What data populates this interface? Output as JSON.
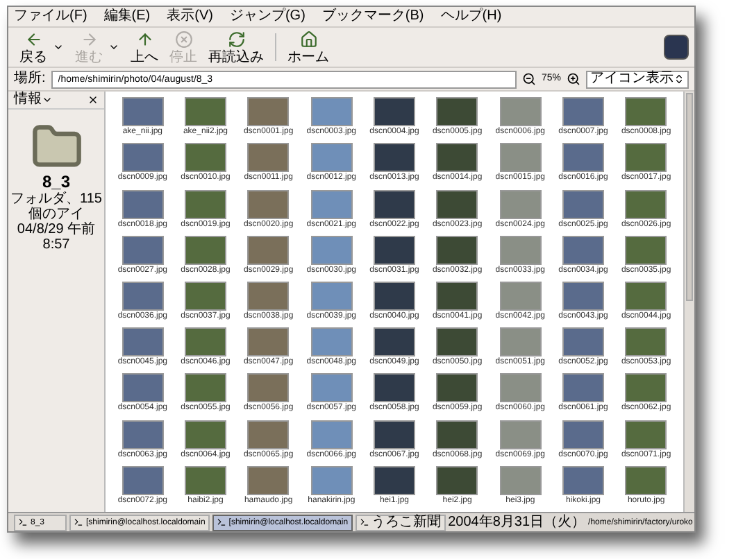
{
  "menu": [
    "ファイル(F)",
    "編集(E)",
    "表示(V)",
    "ジャンプ(G)",
    "ブックマーク(B)",
    "ヘルプ(H)"
  ],
  "toolbar": [
    {
      "kind": "back",
      "label": "戻る",
      "disabled": false,
      "dropdown": true
    },
    {
      "kind": "forward",
      "label": "進む",
      "disabled": true,
      "dropdown": true
    },
    {
      "kind": "up",
      "label": "上へ",
      "disabled": false,
      "dropdown": false
    },
    {
      "kind": "stop",
      "label": "停止",
      "disabled": true,
      "dropdown": false
    },
    {
      "kind": "reload",
      "label": "再読込み",
      "disabled": false,
      "dropdown": false
    },
    {
      "kind": "home",
      "label": "ホーム",
      "disabled": false,
      "dropdown": false
    }
  ],
  "location": {
    "label": "場所:",
    "value": "/home/shimirin/photo/04/august/8_3"
  },
  "zoom": "75%",
  "view_mode": "アイコン表示",
  "sidebar": {
    "header": "情報",
    "name": "8_3",
    "info": "フォルダ、115 個のアイ",
    "date": "04/8/29 午前 8:57"
  },
  "files": [
    "ake_nii.jpg",
    "ake_nii2.jpg",
    "dscn0001.jpg",
    "dscn0003.jpg",
    "dscn0004.jpg",
    "dscn0005.jpg",
    "dscn0006.jpg",
    "dscn0007.jpg",
    "dscn0008.jpg",
    "dscn0009.jpg",
    "dscn0010.jpg",
    "dscn0011.jpg",
    "dscn0012.jpg",
    "dscn0013.jpg",
    "dscn0014.jpg",
    "dscn0015.jpg",
    "dscn0016.jpg",
    "dscn0017.jpg",
    "dscn0018.jpg",
    "dscn0019.jpg",
    "dscn0020.jpg",
    "dscn0021.jpg",
    "dscn0022.jpg",
    "dscn0023.jpg",
    "dscn0024.jpg",
    "dscn0025.jpg",
    "dscn0026.jpg",
    "dscn0027.jpg",
    "dscn0028.jpg",
    "dscn0029.jpg",
    "dscn0030.jpg",
    "dscn0031.jpg",
    "dscn0032.jpg",
    "dscn0033.jpg",
    "dscn0034.jpg",
    "dscn0035.jpg",
    "dscn0036.jpg",
    "dscn0037.jpg",
    "dscn0038.jpg",
    "dscn0039.jpg",
    "dscn0040.jpg",
    "dscn0041.jpg",
    "dscn0042.jpg",
    "dscn0043.jpg",
    "dscn0044.jpg",
    "dscn0045.jpg",
    "dscn0046.jpg",
    "dscn0047.jpg",
    "dscn0048.jpg",
    "dscn0049.jpg",
    "dscn0050.jpg",
    "dscn0051.jpg",
    "dscn0052.jpg",
    "dscn0053.jpg",
    "dscn0054.jpg",
    "dscn0055.jpg",
    "dscn0056.jpg",
    "dscn0057.jpg",
    "dscn0058.jpg",
    "dscn0059.jpg",
    "dscn0060.jpg",
    "dscn0061.jpg",
    "dscn0062.jpg",
    "dscn0063.jpg",
    "dscn0064.jpg",
    "dscn0065.jpg",
    "dscn0066.jpg",
    "dscn0067.jpg",
    "dscn0068.jpg",
    "dscn0069.jpg",
    "dscn0070.jpg",
    "dscn0071.jpg",
    "dscn0072.jpg",
    "haibi2.jpg",
    "hamaudo.jpg",
    "hanakirin.jpg",
    "hei1.jpg",
    "hei2.jpg",
    "hei3.jpg",
    "hikoki.jpg",
    "horuto.jpg"
  ],
  "taskbar": [
    {
      "label": "8_3",
      "selected": false
    },
    {
      "label": "[shimirin@localhost.localdomain",
      "selected": false
    },
    {
      "label": "[shimirin@localhost.localdomain",
      "selected": true
    },
    {
      "label": "うろこ新聞",
      "selected": false
    }
  ],
  "taskbar_title": {
    "date": "2004年8月31日（火）",
    "path": "/home/shimirin/factory/uroko"
  }
}
